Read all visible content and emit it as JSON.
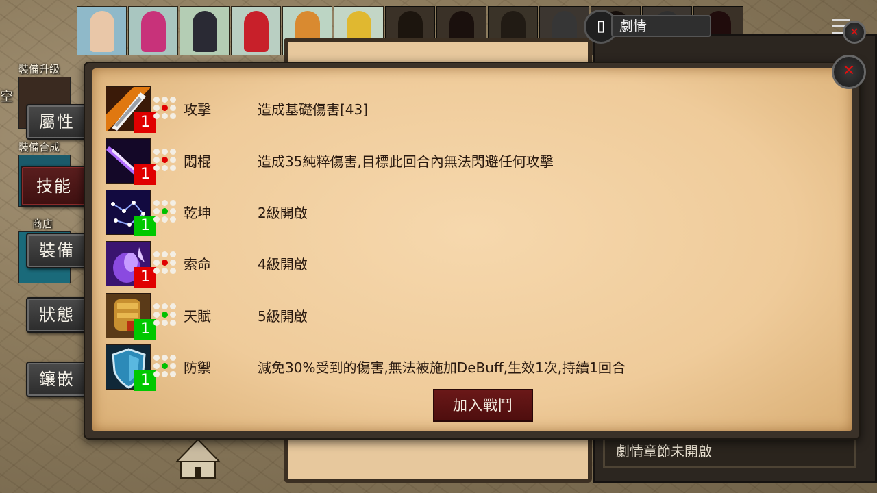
{
  "sidebar": {
    "labels": {
      "equip_upgrade": "裝備升級",
      "equip_synth": "裝備合成",
      "shop": "商店",
      "partial": "空"
    },
    "tabs": [
      {
        "label": "屬性",
        "active": false
      },
      {
        "label": "技能",
        "active": true
      },
      {
        "label": "裝備",
        "active": false
      },
      {
        "label": "狀態",
        "active": false
      },
      {
        "label": "鑲嵌",
        "active": false
      }
    ]
  },
  "story": {
    "title": "劇情",
    "footer": "劇情章節未開啟"
  },
  "skills": [
    {
      "name": "攻擊",
      "desc": "造成基礎傷害[43]",
      "level": "1",
      "level_color": "red",
      "dot_color": "#e00000",
      "icon": "blade-slash-icon"
    },
    {
      "name": "悶棍",
      "desc": "造成35純粹傷害,目標此回合內無法閃避任何攻擊",
      "level": "1",
      "level_color": "red",
      "dot_color": "#e00000",
      "icon": "purple-strike-icon"
    },
    {
      "name": "乾坤",
      "desc": "2級開啟",
      "level": "1",
      "level_color": "green",
      "dot_color": "#00c000",
      "icon": "constellation-icon"
    },
    {
      "name": "索命",
      "desc": "4級開啟",
      "level": "1",
      "level_color": "red",
      "dot_color": "#e00000",
      "icon": "spirit-hand-icon"
    },
    {
      "name": "天賦",
      "desc": "5級開啟",
      "level": "1",
      "level_color": "green",
      "dot_color": "#00c000",
      "icon": "gauntlet-icon"
    },
    {
      "name": "防禦",
      "desc": "減免30%受到的傷害,無法被施加DeBuff,生效1次,持續1回合",
      "level": "1",
      "level_color": "green",
      "dot_color": "#00c000",
      "icon": "shield-icon"
    }
  ],
  "actions": {
    "join_battle": "加入戰鬥"
  }
}
